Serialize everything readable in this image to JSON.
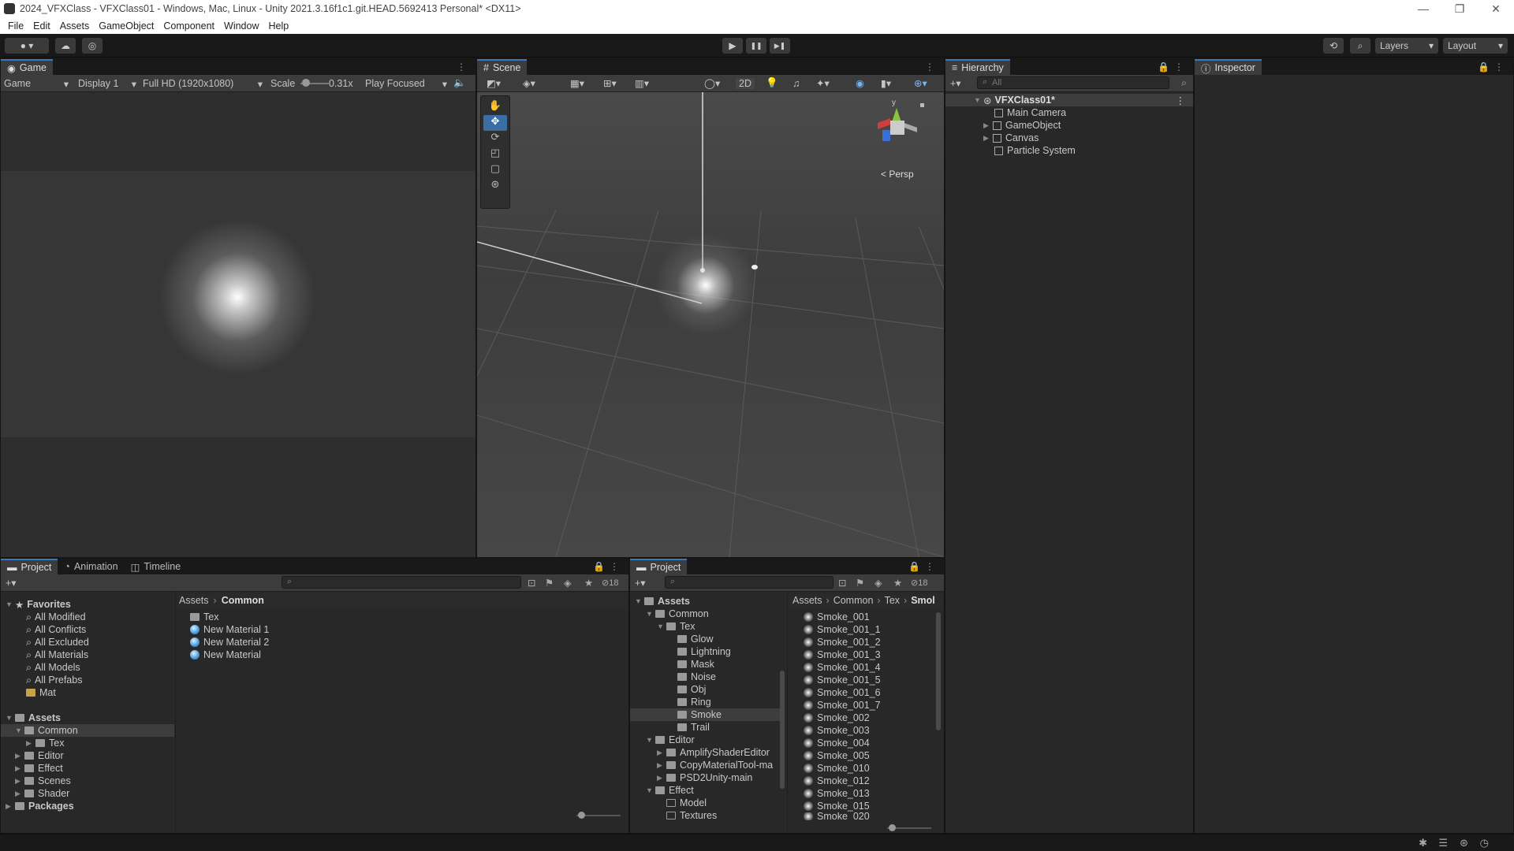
{
  "window": {
    "title": "2024_VFXClass - VFXClass01 - Windows, Mac, Linux - Unity 2021.3.16f1c1.git.HEAD.5692413 Personal* <DX11>",
    "minimize": "—",
    "restore": "❐",
    "close": "✕"
  },
  "menu": [
    "File",
    "Edit",
    "Assets",
    "GameObject",
    "Component",
    "Window",
    "Help"
  ],
  "toolbar": {
    "play": "▶",
    "pause": "❚❚",
    "step": "▶❚",
    "layers_label": "Layers",
    "layout_label": "Layout"
  },
  "game": {
    "tab": "Game",
    "mode": "Game",
    "display": "Display 1",
    "resolution": "Full HD (1920x1080)",
    "scale_label": "Scale",
    "scale_value": "0.31x",
    "play_focused": "Play Focused"
  },
  "scene": {
    "tab": "Scene",
    "mode_2d": "2D",
    "persp_label": "< Persp",
    "gizmo_y": "y"
  },
  "hierarchy": {
    "tab": "Hierarchy",
    "search_placeholder": "All",
    "scene_name": "VFXClass01*",
    "items": [
      "Main Camera",
      "GameObject",
      "Canvas",
      "Particle System"
    ]
  },
  "inspector": {
    "tab": "Inspector"
  },
  "project_left": {
    "tabs": [
      "Project",
      "Animation",
      "Timeline"
    ],
    "hidden_count": "18",
    "favorites_label": "Favorites",
    "favorites": [
      "All Modified",
      "All Conflicts",
      "All Excluded",
      "All Materials",
      "All Models",
      "All Prefabs",
      "Mat"
    ],
    "assets_label": "Assets",
    "assets_tree": [
      "Common",
      "Tex",
      "Editor",
      "Effect",
      "Scenes",
      "Shader"
    ],
    "packages_label": "Packages",
    "breadcrumb": [
      "Assets",
      "Common"
    ],
    "files": [
      "Tex",
      "New Material 1",
      "New Material 2",
      "New Material"
    ]
  },
  "project_right": {
    "tab": "Project",
    "hidden_count": "18",
    "tree": [
      "Assets",
      "Common",
      "Tex",
      "Glow",
      "Lightning",
      "Mask",
      "Noise",
      "Obj",
      "Ring",
      "Smoke",
      "Trail",
      "Editor",
      "AmplifyShaderEditor",
      "CopyMaterialTool-ma",
      "PSD2Unity-main",
      "Effect",
      "Model",
      "Textures"
    ],
    "breadcrumb": [
      "Assets",
      "Common",
      "Tex",
      "Smol"
    ],
    "files": [
      "Smoke_001",
      "Smoke_001_1",
      "Smoke_001_2",
      "Smoke_001_3",
      "Smoke_001_4",
      "Smoke_001_5",
      "Smoke_001_6",
      "Smoke_001_7",
      "Smoke_002",
      "Smoke_003",
      "Smoke_004",
      "Smoke_005",
      "Smoke_010",
      "Smoke_012",
      "Smoke_013",
      "Smoke_015",
      "Smoke_020"
    ]
  },
  "colors": {
    "accent": "#3a79bb",
    "panel_bg": "#282828",
    "scene_bg": "#474747",
    "gizmo_x": "#d33c3c",
    "gizmo_y": "#8ac43f",
    "gizmo_z": "#3a6fd8"
  }
}
